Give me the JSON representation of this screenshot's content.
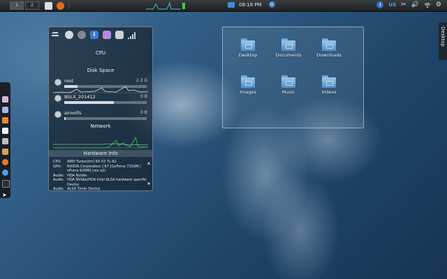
{
  "top_panel": {
    "pager": [
      "1",
      "2"
    ],
    "clock": "08:18 PM",
    "tray": {
      "lang": "US",
      "update_badge": "G"
    }
  },
  "desktop_tab": {
    "label": "Desktop"
  },
  "sysmon": {
    "sections": {
      "cpu": "CPU",
      "disk": "Disk Space",
      "network": "Network",
      "hardware": "Hardware Info"
    },
    "disks": [
      {
        "name": "root",
        "value": "2.3 G",
        "fill": 0.16
      },
      {
        "name": "BSLX_201412",
        "value": "0 B",
        "fill": 0.6
      },
      {
        "name": "airootfs",
        "value": "0 B",
        "fill": 0.02
      }
    ],
    "hardware": [
      {
        "key": "CPU:",
        "value": "AMD Turion(tm) 64 X2 TL-62"
      },
      {
        "key": "GPU:",
        "value": "NVIDIA Corporation C67 [GeForce 7150M / nForce 630M] (rev a2)"
      },
      {
        "key": "Audio:",
        "value": "HDA Nvidia"
      },
      {
        "key": "Audio:",
        "value": "HDA NVidia/HDA Intel ALSA hardware specific Device"
      },
      {
        "key": "Audio:",
        "value": "ALSA Timer Device"
      }
    ]
  },
  "folderview": {
    "items": [
      {
        "label": "Desktop"
      },
      {
        "label": "Documents"
      },
      {
        "label": "Downloads"
      },
      {
        "label": "Images"
      },
      {
        "label": "Music"
      },
      {
        "label": "Videos"
      }
    ]
  },
  "colors": {
    "accent": "#3a7bd5",
    "panel": "#1e2022",
    "wallpaper": "#2e5a82"
  },
  "icons": {
    "tray": [
      "info-icon",
      "scissors-icon",
      "volume-icon",
      "wifi-icon",
      "gear-icon"
    ],
    "launcher": [
      "dolphin-icon",
      "terminal-icon",
      "media-icon",
      "document-icon",
      "mail-icon",
      "app-icon",
      "firefox-icon",
      "browser-icon",
      "console-icon",
      "cursor-icon"
    ]
  }
}
